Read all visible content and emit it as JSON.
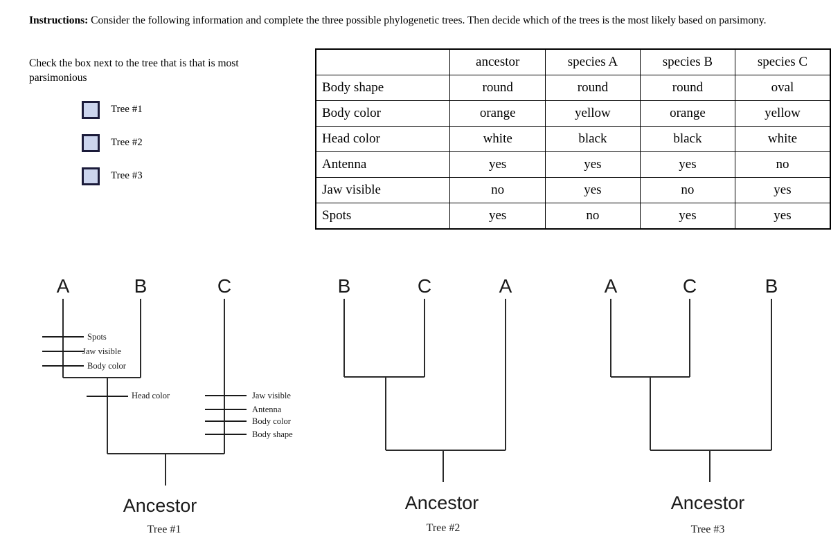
{
  "instructions": {
    "lead": "Instructions:",
    "body": "  Consider the following information and complete the three possible phylogenetic trees.  Then decide which of the trees is the most likely based on parsimony."
  },
  "check_panel": {
    "prompt": "Check the box next to the tree that is that is most parsimonious",
    "options": [
      {
        "label": "Tree #1",
        "checked": false
      },
      {
        "label": "Tree #2",
        "checked": false
      },
      {
        "label": "Tree #3",
        "checked": false
      }
    ]
  },
  "table": {
    "corner": "",
    "columns": [
      "ancestor",
      "species A",
      "species B",
      "species C"
    ],
    "rows": [
      {
        "trait": "Body shape",
        "values": [
          "round",
          "round",
          "round",
          "oval"
        ]
      },
      {
        "trait": "Body color",
        "values": [
          "orange",
          "yellow",
          "orange",
          "yellow"
        ]
      },
      {
        "trait": "Head color",
        "values": [
          "white",
          "black",
          "black",
          "white"
        ]
      },
      {
        "trait": "Antenna",
        "values": [
          "yes",
          "yes",
          "yes",
          "no"
        ]
      },
      {
        "trait": "Jaw visible",
        "values": [
          "no",
          "yes",
          "no",
          "yes"
        ]
      },
      {
        "trait": "Spots",
        "values": [
          "yes",
          "no",
          "yes",
          "yes"
        ]
      }
    ]
  },
  "trees": [
    {
      "id": "tree-1",
      "taxa": [
        "A",
        "B",
        "C"
      ],
      "ancestor_label": "Ancestor",
      "caption": "Tree #1",
      "trait_marks": [
        {
          "branch": "A",
          "label": "Spots"
        },
        {
          "branch": "A",
          "label": "Jaw visible"
        },
        {
          "branch": "A",
          "label": "Body color"
        },
        {
          "branch": "AB-stem",
          "label": "Head  color"
        },
        {
          "branch": "C",
          "label": "Jaw visible"
        },
        {
          "branch": "C",
          "label": "Antenna"
        },
        {
          "branch": "C",
          "label": "Body color"
        },
        {
          "branch": "C",
          "label": "Body shape"
        }
      ]
    },
    {
      "id": "tree-2",
      "taxa": [
        "B",
        "C",
        "A"
      ],
      "ancestor_label": "Ancestor",
      "caption": "Tree #2",
      "trait_marks": []
    },
    {
      "id": "tree-3",
      "taxa": [
        "A",
        "C",
        "B"
      ],
      "ancestor_label": "Ancestor",
      "caption": "Tree #3",
      "trait_marks": []
    }
  ],
  "colors": {
    "checkbox_fill": "#ccd5ee",
    "checkbox_border": "#1b1b3a",
    "line": "#2a2a2a",
    "text": "#000000"
  }
}
